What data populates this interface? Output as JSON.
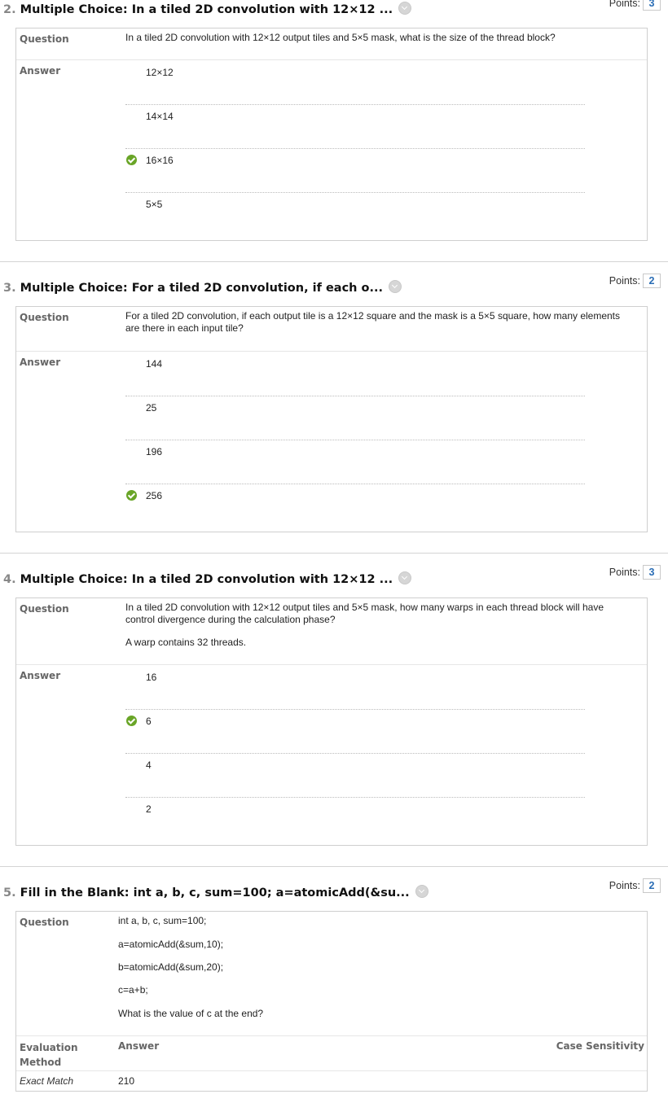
{
  "questions": [
    {
      "number": "2.",
      "title": "Multiple Choice: In a tiled 2D convolution with 12×12 ...",
      "points_label": "Points:",
      "points": "3",
      "question_label": "Question",
      "answer_label": "Answer",
      "question_text": "In a tiled 2D convolution with 12×12 output tiles and 5×5 mask, what is the size of the thread block?",
      "answers": [
        "12×12",
        "14×14",
        "16×16",
        "5×5"
      ],
      "correct_index": 2
    },
    {
      "number": "3.",
      "title": "Multiple Choice: For a tiled 2D convolution, if each o...",
      "points_label": "Points:",
      "points": "2",
      "question_label": "Question",
      "answer_label": "Answer",
      "question_text": "For a tiled 2D convolution, if each output tile is a 12×12 square and the mask is a 5×5 square, how many elements are there in each input tile?",
      "answers": [
        "144",
        "25",
        "196",
        "256"
      ],
      "correct_index": 3
    },
    {
      "number": "4.",
      "title": "Multiple Choice: In a tiled 2D convolution with 12×12 ...",
      "points_label": "Points:",
      "points": "3",
      "question_label": "Question",
      "answer_label": "Answer",
      "question_text": "In a tiled 2D convolution with 12×12 output tiles and 5×5 mask, how many warps in each thread block will have control divergence during the calculation phase?",
      "question_text_2": "A warp contains 32 threads.",
      "answers": [
        "16",
        "6",
        "4",
        "2"
      ],
      "correct_index": 1
    },
    {
      "number": "5.",
      "title": "Fill in the Blank: int a, b, c, sum=100; a=atomicAdd(&su...",
      "points_label": "Points:",
      "points": "2",
      "question_label": "Question",
      "question_lines": [
        "int a, b, c, sum=100;",
        "a=atomicAdd(&sum,10);",
        "b=atomicAdd(&sum,20);",
        "c=a+b;",
        "What is the value of c at the end?"
      ],
      "eval_header": "Evaluation Method",
      "answer_header": "Answer",
      "case_header": "Case Sensitivity",
      "eval_value": "Exact Match",
      "answer_value": "210"
    }
  ],
  "icons": {
    "collapse": "chevron-down-icon",
    "correct": "check-circle-icon"
  },
  "colors": {
    "correct_green": "#69a527",
    "points_blue": "#2a6db5",
    "border": "#cfcfcf"
  }
}
